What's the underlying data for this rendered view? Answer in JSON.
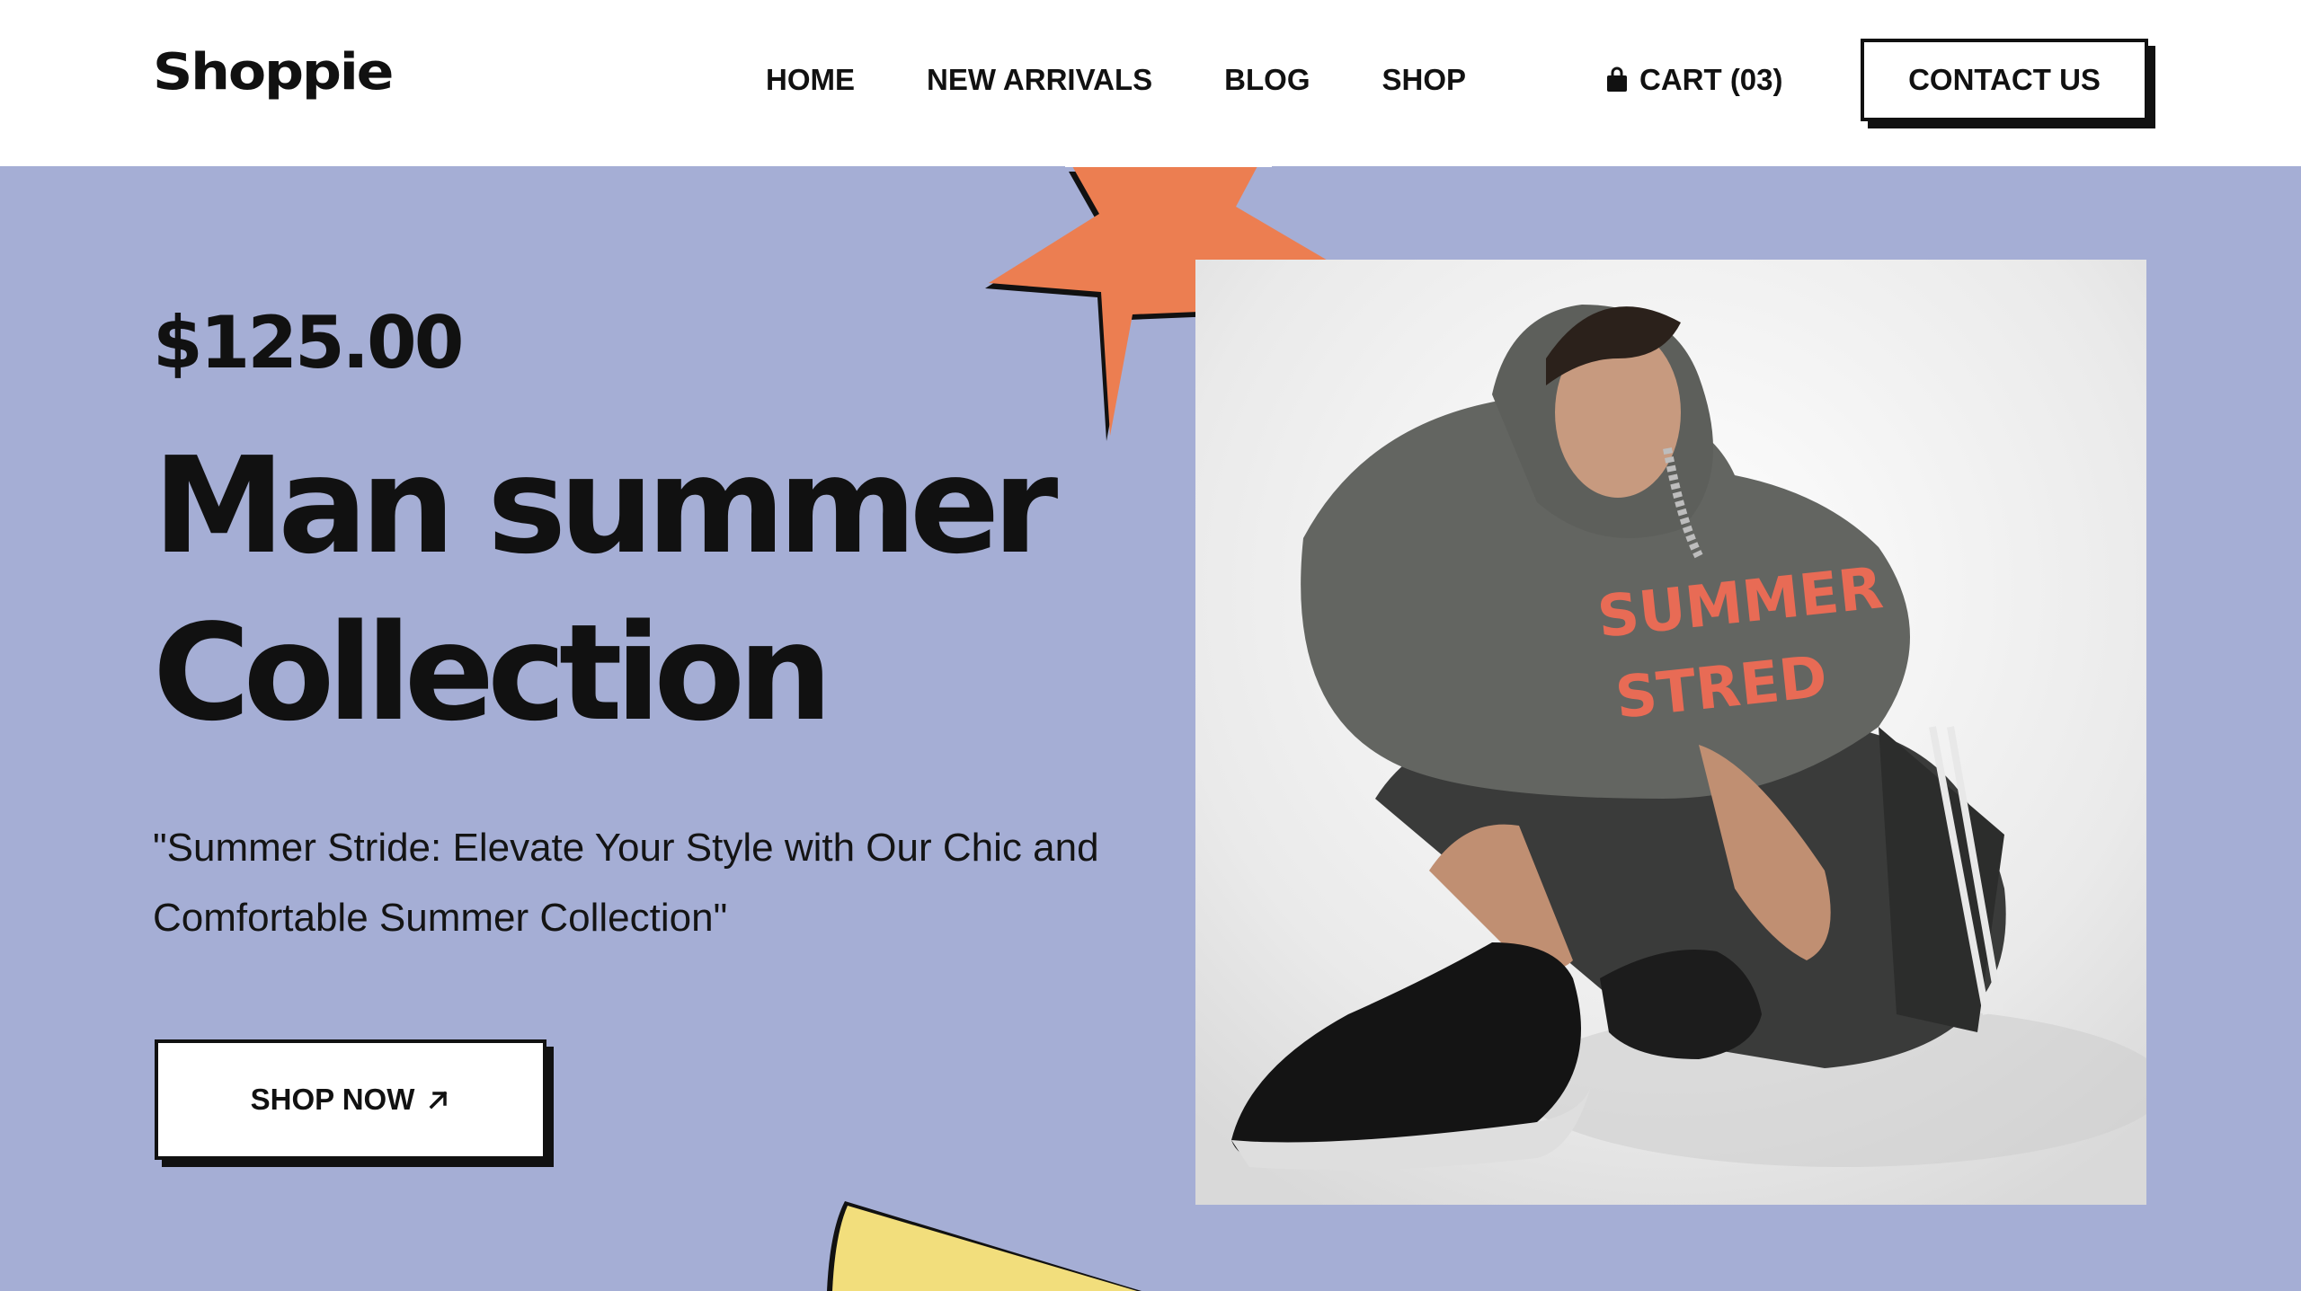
{
  "brand": {
    "logo_text": "Shoppie"
  },
  "nav": {
    "items": [
      "HOME",
      "NEW ARRIVALS",
      "BLOG",
      "SHOP"
    ]
  },
  "cart": {
    "label": "CART (03)",
    "icon": "shopping-bag-icon"
  },
  "contact": {
    "label": "CONTACT US"
  },
  "hero": {
    "price": "$125.00",
    "title_line1": "Man summer",
    "title_line2": "Collection",
    "description": "\"Summer Stride: Elevate Your Style with Our Chic and Comfortable Summer Collection\"",
    "cta_label": "SHOP NOW",
    "cta_icon": "arrow-up-right-icon",
    "image_text_line1": "SUMMER",
    "image_text_line2": "STRED"
  },
  "colors": {
    "background": "#a5aed5",
    "header": "#ffffff",
    "star": "#ec7e51",
    "blob": "#f2de7c",
    "text": "#111111"
  }
}
